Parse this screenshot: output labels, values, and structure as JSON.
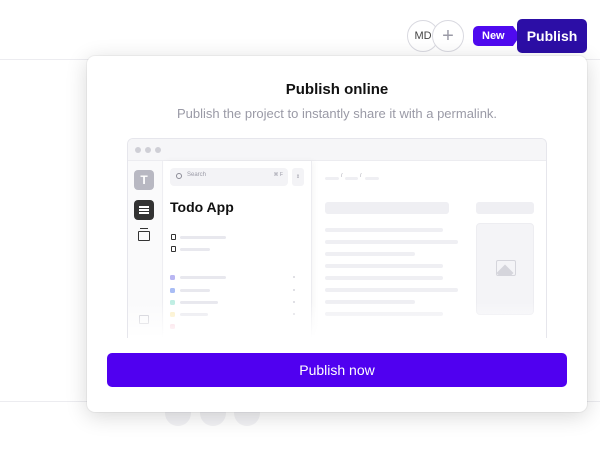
{
  "header": {
    "avatar_initials": "MD",
    "add_symbol": "+",
    "new_badge": "New",
    "publish_label": "Publish"
  },
  "modal": {
    "title": "Publish online",
    "subtitle": "Publish the project to instantly share it with a permalink.",
    "button_label": "Publish now"
  },
  "preview": {
    "workspace_initial": "T",
    "search_label": "Search",
    "search_shortcut": "⌘ F",
    "filter_symbol": "⇕",
    "app_title": "Todo App",
    "breadcrumb_separator": "/"
  },
  "colors": {
    "accent": "#5000f0",
    "publish_button": "#2c0ea6",
    "badge": "#4f0aef",
    "tag_colors": [
      "#b9b6f2",
      "#a9bdf5",
      "#bfeee3",
      "#fbeec2",
      "#f8c9d6"
    ]
  },
  "icons": {
    "add": "plus-icon",
    "search": "search-icon",
    "document": "document-icon",
    "layers": "layers-icon",
    "image": "image-placeholder-icon",
    "speaker": "speaker-icon"
  }
}
